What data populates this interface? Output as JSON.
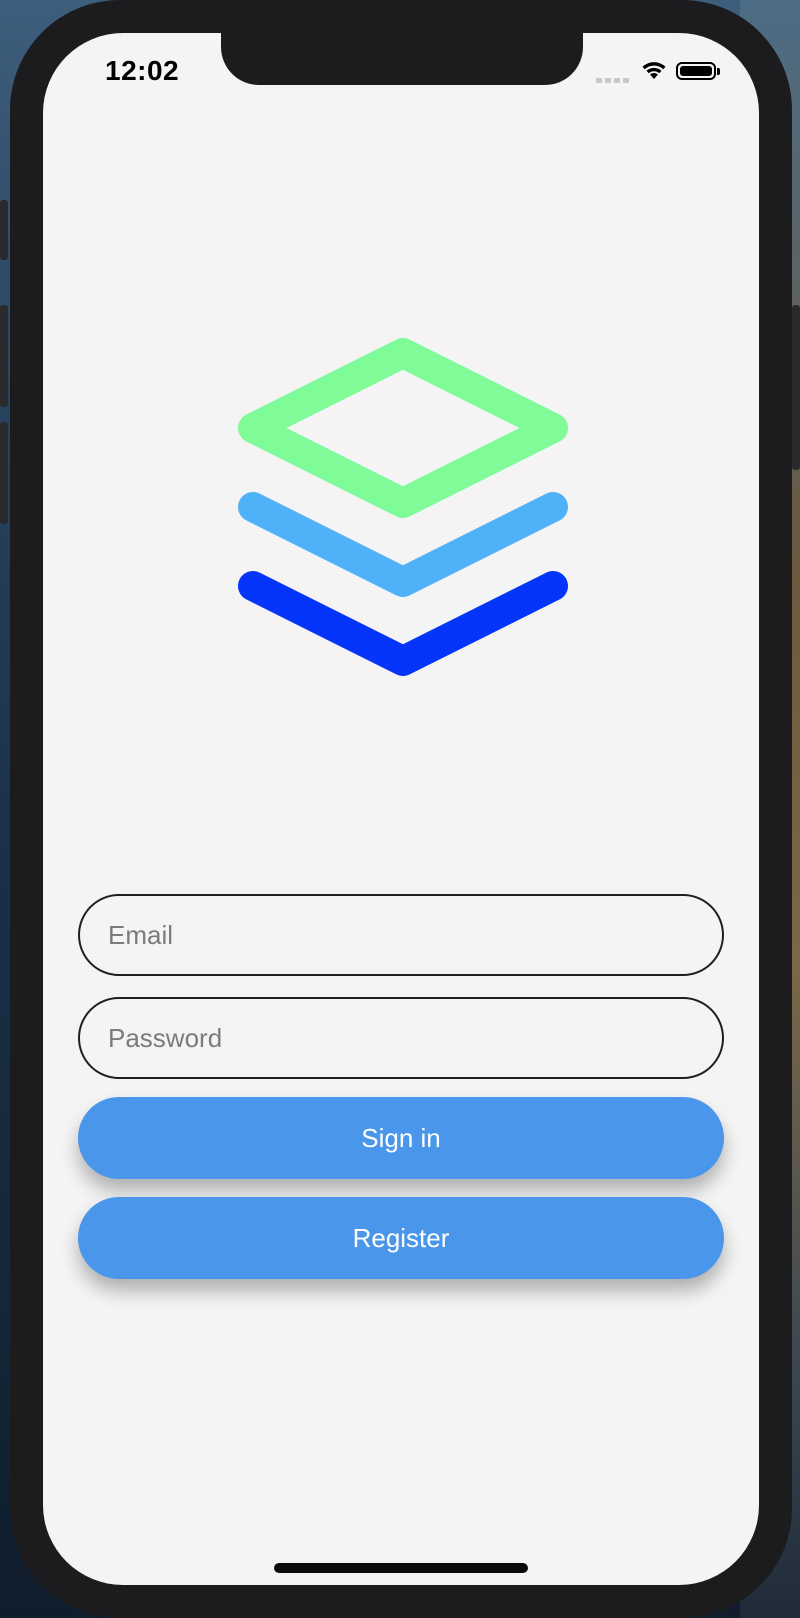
{
  "status_bar": {
    "time": "12:02"
  },
  "logo": {
    "icon": "layers-icon",
    "colors": {
      "top_layer": "#7ffb97",
      "middle_layer": "#4fb1f8",
      "bottom_layer": "#0535fa"
    }
  },
  "form": {
    "email_placeholder": "Email",
    "email_value": "",
    "password_placeholder": "Password",
    "password_value": ""
  },
  "buttons": {
    "sign_in_label": "Sign in",
    "register_label": "Register"
  },
  "colors": {
    "button": "#4a96ea",
    "screen_background": "#f4f4f4"
  }
}
